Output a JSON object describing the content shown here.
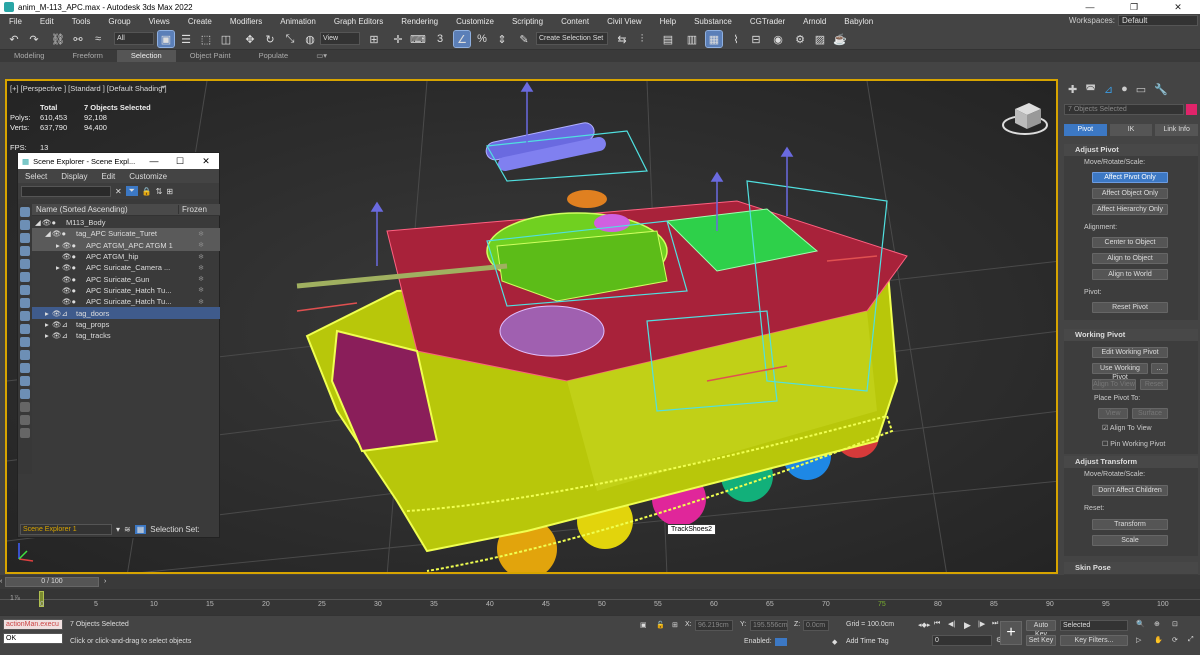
{
  "window": {
    "title": "anim_M-113_APC.max - Autodesk 3ds Max 2022"
  },
  "menu": [
    "File",
    "Edit",
    "Tools",
    "Group",
    "Views",
    "Create",
    "Modifiers",
    "Animation",
    "Graph Editors",
    "Rendering",
    "Customize",
    "Scripting",
    "Content",
    "Civil View",
    "Help",
    "Substance",
    "CGTrader",
    "Arnold",
    "Babylon"
  ],
  "workspaces": {
    "label": "Workspaces:",
    "value": "Default"
  },
  "toolbar": {
    "filter": "All",
    "coord": "View",
    "selection_set": "Create Selection Set"
  },
  "ribbon": [
    "Modeling",
    "Freeform",
    "Selection",
    "Object Paint",
    "Populate"
  ],
  "viewport": {
    "label": "[+] [Perspective ] [Standard ] [Default Shading ]",
    "stats": {
      "h_total": "Total",
      "h_sel": "7 Objects Selected",
      "polys_label": "Polys:",
      "polys_total": "610,453",
      "polys_sel": "92,108",
      "verts_label": "Verts:",
      "verts_total": "637,790",
      "verts_sel": "94,400",
      "fps_label": "FPS:",
      "fps_value": "13"
    },
    "tooltip": "TrackShoes2"
  },
  "scene_explorer": {
    "title": "Scene Explorer - Scene Expl...",
    "menu": [
      "Select",
      "Display",
      "Edit",
      "Customize"
    ],
    "col_name": "Name (Sorted Ascending)",
    "col_frozen": "Frozen",
    "rows": [
      {
        "label": "M113_Body",
        "indent": 0
      },
      {
        "label": "tag_APC Suricate_Turet",
        "indent": 1
      },
      {
        "label": "APC ATGM_APC ATGM 1",
        "indent": 2
      },
      {
        "label": "APC ATGM_hip",
        "indent": 2
      },
      {
        "label": "APC Suricate_Camera ...",
        "indent": 2
      },
      {
        "label": "APC Suricate_Gun",
        "indent": 2
      },
      {
        "label": "APC Suricate_Hatch Tu...",
        "indent": 2
      },
      {
        "label": "APC Suricate_Hatch Tu...",
        "indent": 2
      },
      {
        "label": "tag_doors",
        "indent": 1
      },
      {
        "label": "tag_props",
        "indent": 1
      },
      {
        "label": "tag_tracks",
        "indent": 1
      }
    ],
    "footer_dropdown": "Scene Explorer 1",
    "footer_label": "Selection Set:"
  },
  "command_panel": {
    "name_field": "7 Objects Selected",
    "subtabs": [
      "Pivot",
      "IK",
      "Link Info"
    ],
    "adjust_pivot": {
      "title": "Adjust Pivot",
      "move_label": "Move/Rotate/Scale:",
      "affect_pivot": "Affect Pivot Only",
      "affect_object": "Affect Object Only",
      "affect_hierarchy": "Affect Hierarchy Only",
      "alignment_label": "Alignment:",
      "center_to_object": "Center to Object",
      "align_to_object": "Align to Object",
      "align_to_world": "Align to World",
      "pivot_label": "Pivot:",
      "reset_pivot": "Reset Pivot"
    },
    "working_pivot": {
      "title": "Working Pivot",
      "edit": "Edit Working Pivot",
      "use": "Use Working Pivot",
      "more": "...",
      "align_to_view": "Align To View",
      "reset": "Reset",
      "place_label": "Place Pivot To:",
      "view": "View",
      "surface": "Surface",
      "align_check": "Align To View",
      "pin": "Pin Working Pivot"
    },
    "adjust_transform": {
      "title": "Adjust Transform",
      "move_label": "Move/Rotate/Scale:",
      "dont_affect": "Don't Affect Children",
      "reset_label": "Reset:",
      "transform": "Transform",
      "scale": "Scale"
    },
    "skin_pose": {
      "title": "Skin Pose"
    }
  },
  "timeline": {
    "slider": "0 / 100",
    "ticks": [
      "0",
      "5",
      "10",
      "15",
      "20",
      "25",
      "30",
      "35",
      "40",
      "45",
      "50",
      "55",
      "60",
      "65",
      "70",
      "75",
      "80",
      "85",
      "90",
      "95",
      "100"
    ]
  },
  "statusbar": {
    "script_line": "actionMan.execu",
    "ok": "OK",
    "selected": "7 Objects Selected",
    "prompt": "Click or click-and-drag to select objects",
    "x_label": "X:",
    "x": "96.219cm",
    "y_label": "Y:",
    "y": "195.556cm",
    "z_label": "Z:",
    "z": "0.0cm",
    "grid": "Grid = 100.0cm",
    "enabled": "Enabled:",
    "add_time_tag": "Add Time Tag",
    "auto_key": "Auto Key",
    "set_key": "Set Key",
    "selected_dropdown": "Selected",
    "key_filters": "Key Filters...",
    "frame": "0",
    "frame_zero": "0"
  }
}
